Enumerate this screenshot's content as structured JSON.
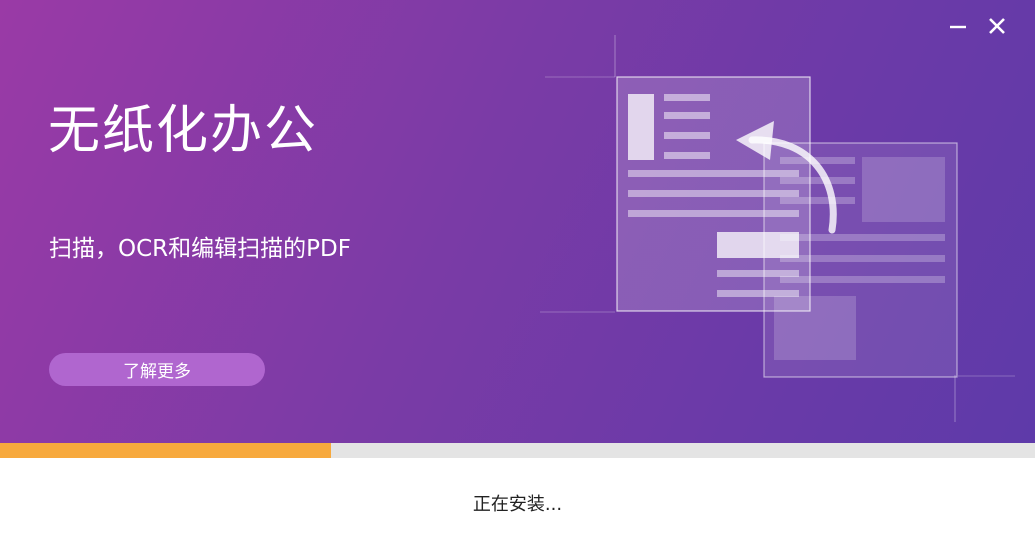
{
  "window": {
    "minimize_icon": "minimize-icon",
    "close_icon": "close-icon"
  },
  "banner": {
    "headline": "无纸化办公",
    "subline": "扫描，OCR和编辑扫描的PDF",
    "learn_more_label": "了解更多",
    "gradient_start": "#9a3aa6",
    "gradient_end": "#5e3aa9",
    "illustration_icon": "document-scan-illustration"
  },
  "install": {
    "progress": 0.32,
    "progress_color": "#f7a93d",
    "status_text": "正在安装..."
  }
}
